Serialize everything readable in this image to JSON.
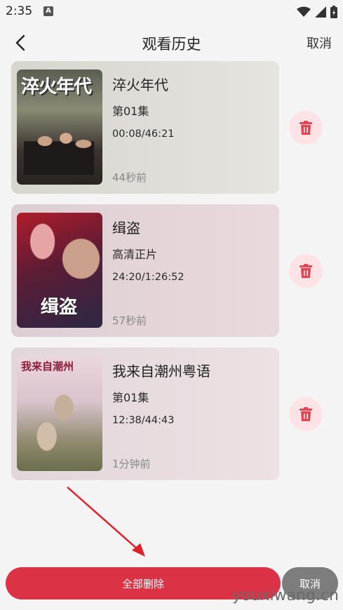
{
  "status_bar": {
    "time": "2:35",
    "notification_letter": "A"
  },
  "header": {
    "title": "观看历史",
    "cancel_label": "取消"
  },
  "history": [
    {
      "title": "淬火年代",
      "episode": "第01集",
      "progress": "00:08/46:21",
      "watched_ago": "44秒前",
      "poster_text": "淬火年代"
    },
    {
      "title": "缉盗",
      "episode": "高清正片",
      "progress": "24:20/1:26:52",
      "watched_ago": "57秒前",
      "poster_text": "缉盗"
    },
    {
      "title": "我来自潮州粤语",
      "episode": "第01集",
      "progress": "12:38/44:43",
      "watched_ago": "1分钟前",
      "poster_text": "我来自潮州"
    }
  ],
  "footer": {
    "delete_all_label": "全部删除",
    "cancel_label": "取消"
  },
  "watermark": "youxiwang.cn",
  "colors": {
    "accent": "#dc3246",
    "delete_bg": "#fde3e6",
    "cancel_bg": "#7d7d7d"
  }
}
